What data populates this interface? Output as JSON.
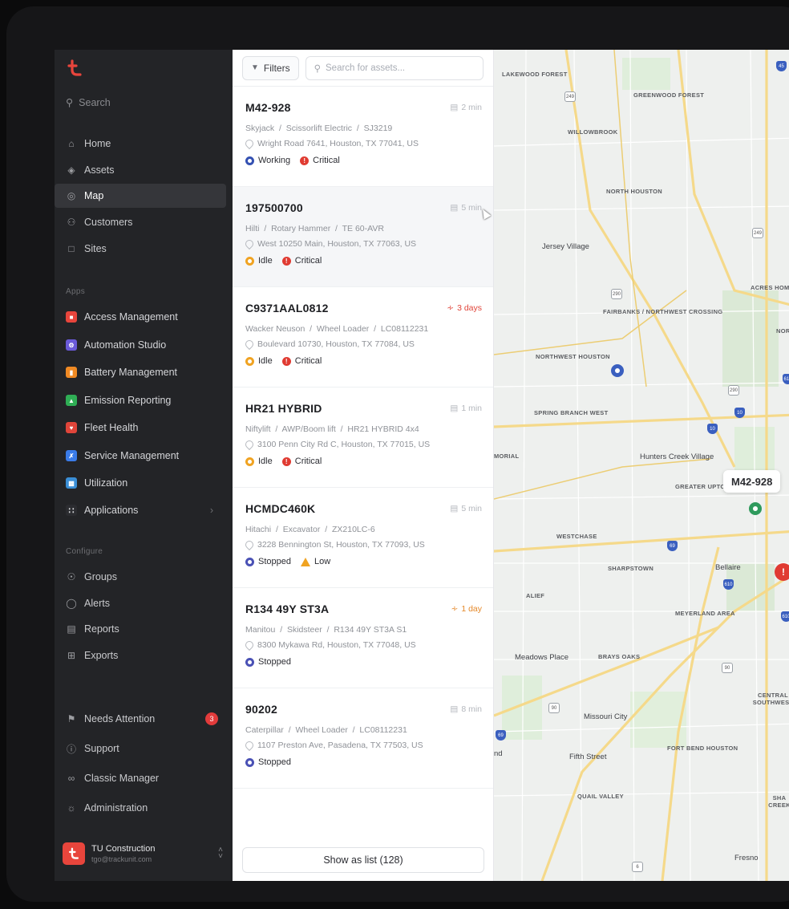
{
  "sidebar": {
    "search_label": "Search",
    "nav": [
      {
        "label": "Home",
        "icon": "home-icon",
        "active": false
      },
      {
        "label": "Assets",
        "icon": "tag-icon",
        "active": false
      },
      {
        "label": "Map",
        "icon": "globe-icon",
        "active": true
      },
      {
        "label": "Customers",
        "icon": "users-icon",
        "active": false
      },
      {
        "label": "Sites",
        "icon": "building-icon",
        "active": false
      }
    ],
    "apps_section_label": "Apps",
    "apps": [
      {
        "label": "Access Management",
        "color": "#e8453c",
        "icon": "lock-icon"
      },
      {
        "label": "Automation Studio",
        "color": "#6a5ad8",
        "icon": "gear-icon"
      },
      {
        "label": "Battery Management",
        "color": "#f08a24",
        "icon": "battery-icon"
      },
      {
        "label": "Emission Reporting",
        "color": "#2fae55",
        "icon": "leaf-icon"
      },
      {
        "label": "Fleet Health",
        "color": "#e0453a",
        "icon": "heart-icon"
      },
      {
        "label": "Service Management",
        "color": "#3a7be8",
        "icon": "wrench-icon"
      },
      {
        "label": "Utilization",
        "color": "#3a8ed6",
        "icon": "chart-icon"
      },
      {
        "label": "Applications",
        "color": "#2b2c30",
        "icon": "grid-icon"
      }
    ],
    "configure_section_label": "Configure",
    "configure": [
      {
        "label": "Groups",
        "icon": "groups-icon"
      },
      {
        "label": "Alerts",
        "icon": "bell-icon"
      },
      {
        "label": "Reports",
        "icon": "report-icon"
      },
      {
        "label": "Exports",
        "icon": "export-icon"
      }
    ],
    "bottom": [
      {
        "label": "Needs Attention",
        "icon": "flag-icon",
        "badge": "3"
      },
      {
        "label": "Support",
        "icon": "help-icon"
      },
      {
        "label": "Classic Manager",
        "icon": "classic-icon"
      },
      {
        "label": "Administration",
        "icon": "admin-icon"
      }
    ],
    "account": {
      "name": "TU Construction",
      "email": "tgo@trackunit.com"
    }
  },
  "list": {
    "filters_label": "Filters",
    "search_placeholder": "Search for assets...",
    "show_list_label": "Show as list (128)",
    "assets": [
      {
        "id": "M42-928",
        "time": "2 min",
        "time_style": "grey",
        "brand": "Skyjack",
        "type": "Scissorlift Electric",
        "model": "SJ3219",
        "address": "Wright Road 7641, Houston, TX 77041, US",
        "status": "Working",
        "status_type": "working",
        "alert": "Critical",
        "alert_type": "critical",
        "selected": false
      },
      {
        "id": "197500700",
        "time": "5 min",
        "time_style": "grey",
        "brand": "Hilti",
        "type": "Rotary Hammer",
        "model": "TE 60-AVR",
        "address": "West 10250 Main, Houston, TX 77063, US",
        "status": "Idle",
        "status_type": "idle",
        "alert": "Critical",
        "alert_type": "critical",
        "selected": true
      },
      {
        "id": "C9371AAL0812",
        "time": "3 days",
        "time_style": "red",
        "brand": "Wacker Neuson",
        "type": "Wheel Loader",
        "model": "LC08112231",
        "address": "Boulevard 10730, Houston, TX 77084, US",
        "status": "Idle",
        "status_type": "idle",
        "alert": "Critical",
        "alert_type": "critical",
        "selected": false
      },
      {
        "id": "HR21 HYBRID",
        "time": "1 min",
        "time_style": "grey",
        "brand": "Niftylift",
        "type": "AWP/Boom lift",
        "model": "HR21 HYBRID 4x4",
        "address": "3100 Penn City Rd C, Houston, TX 77015, US",
        "status": "Idle",
        "status_type": "idle",
        "alert": "Critical",
        "alert_type": "critical",
        "selected": false
      },
      {
        "id": "HCMDC460K",
        "time": "5 min",
        "time_style": "grey",
        "brand": "Hitachi",
        "type": "Excavator",
        "model": "ZX210LC-6",
        "address": "3228 Bennington St, Houston, TX 77093, US",
        "status": "Stopped",
        "status_type": "stopped",
        "alert": "Low",
        "alert_type": "low",
        "selected": false
      },
      {
        "id": "R134 49Y ST3A",
        "time": "1 day",
        "time_style": "orange",
        "brand": "Manitou",
        "type": "Skidsteer",
        "model": "R134 49Y ST3A S1",
        "address": "8300 Mykawa Rd, Houston, TX 77048, US",
        "status": "Stopped",
        "status_type": "stopped",
        "alert": "",
        "alert_type": "",
        "selected": false
      },
      {
        "id": "90202",
        "time": "8 min",
        "time_style": "grey",
        "brand": "Caterpillar",
        "type": "Wheel Loader",
        "model": "LC08112231",
        "address": "1107 Preston Ave, Pasadena, TX 77503, US",
        "status": "Stopped",
        "status_type": "stopped",
        "alert": "",
        "alert_type": "",
        "selected": false
      }
    ]
  },
  "map": {
    "callout": "M42-928",
    "labels": [
      {
        "text": "LAKEWOOD FOREST",
        "kind": "area"
      },
      {
        "text": "GREENWOOD FOREST",
        "kind": "area"
      },
      {
        "text": "WILLOWBROOK",
        "kind": "area"
      },
      {
        "text": "NORTH HOUSTON",
        "kind": "area"
      },
      {
        "text": "Jersey Village",
        "kind": "place"
      },
      {
        "text": "ACRES HOM",
        "kind": "area"
      },
      {
        "text": "FAIRBANKS / NORTHWEST CROSSING",
        "kind": "area"
      },
      {
        "text": "NOR",
        "kind": "area"
      },
      {
        "text": "NORTHWEST HOUSTON",
        "kind": "area"
      },
      {
        "text": "SPRING BRANCH WEST",
        "kind": "area"
      },
      {
        "text": "MORIAL",
        "kind": "area"
      },
      {
        "text": "Hunters Creek Village",
        "kind": "place"
      },
      {
        "text": "GREATER UPTOWN",
        "kind": "area"
      },
      {
        "text": "WESTCHASE",
        "kind": "area"
      },
      {
        "text": "SHARPSTOWN",
        "kind": "area"
      },
      {
        "text": "Bellaire",
        "kind": "place"
      },
      {
        "text": "ALIEF",
        "kind": "area"
      },
      {
        "text": "MEYERLAND AREA",
        "kind": "area"
      },
      {
        "text": "Meadows Place",
        "kind": "place"
      },
      {
        "text": "BRAYS OAKS",
        "kind": "area"
      },
      {
        "text": "Missouri City",
        "kind": "place"
      },
      {
        "text": "CENTRAL SOUTHWEST",
        "kind": "area"
      },
      {
        "text": "nd",
        "kind": "place"
      },
      {
        "text": "Fifth Street",
        "kind": "place"
      },
      {
        "text": "FORT BEND HOUSTON",
        "kind": "area"
      },
      {
        "text": "QUAIL VALLEY",
        "kind": "area"
      },
      {
        "text": "SHA CREEK",
        "kind": "area"
      },
      {
        "text": "Fresno",
        "kind": "place"
      }
    ]
  }
}
